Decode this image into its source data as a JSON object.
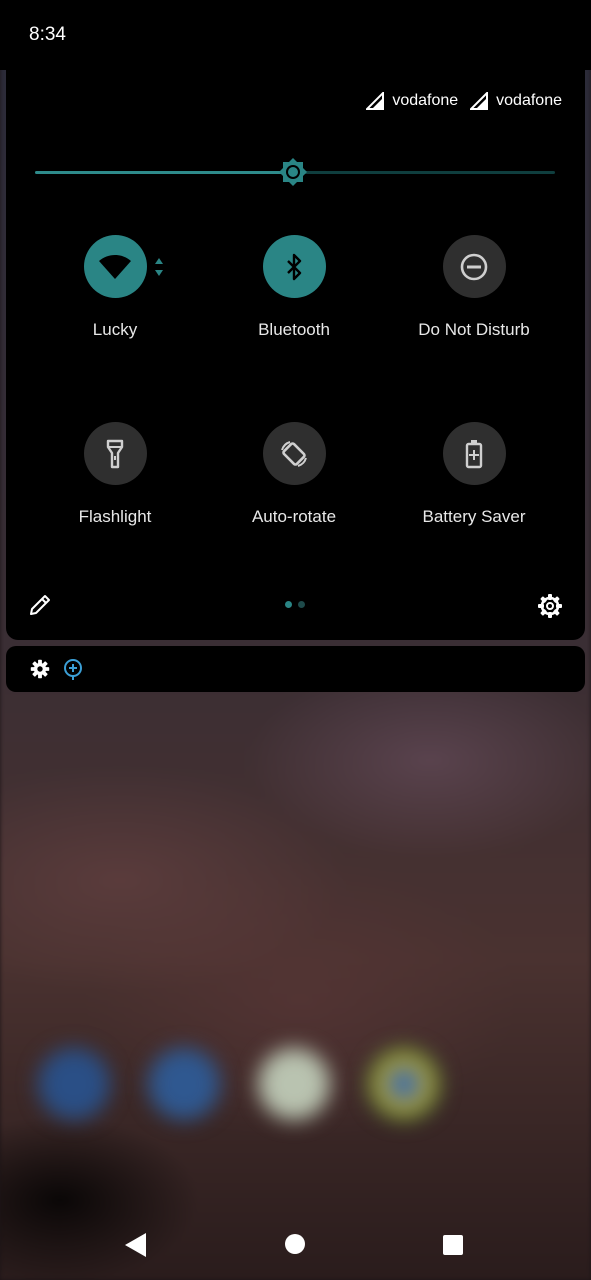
{
  "status_bar": {
    "time": "8:34"
  },
  "carriers": [
    {
      "name": "vodafone"
    },
    {
      "name": "vodafone"
    }
  ],
  "brightness": {
    "level": 0.49
  },
  "tiles": [
    {
      "label": "Lucky",
      "icon": "wifi-icon",
      "state": "on"
    },
    {
      "label": "Bluetooth",
      "icon": "bluetooth-icon",
      "state": "on"
    },
    {
      "label": "Do Not Disturb",
      "icon": "do-not-disturb-icon",
      "state": "off"
    },
    {
      "label": "Flashlight",
      "icon": "flashlight-icon",
      "state": "off"
    },
    {
      "label": "Auto-rotate",
      "icon": "auto-rotate-icon",
      "state": "off"
    },
    {
      "label": "Battery Saver",
      "icon": "battery-saver-icon",
      "state": "off"
    }
  ],
  "pager": {
    "pages": 2,
    "current": 1
  },
  "colors": {
    "accent": "#2a8585",
    "tile_off": "#2f2f2f",
    "panel": "#000000"
  }
}
